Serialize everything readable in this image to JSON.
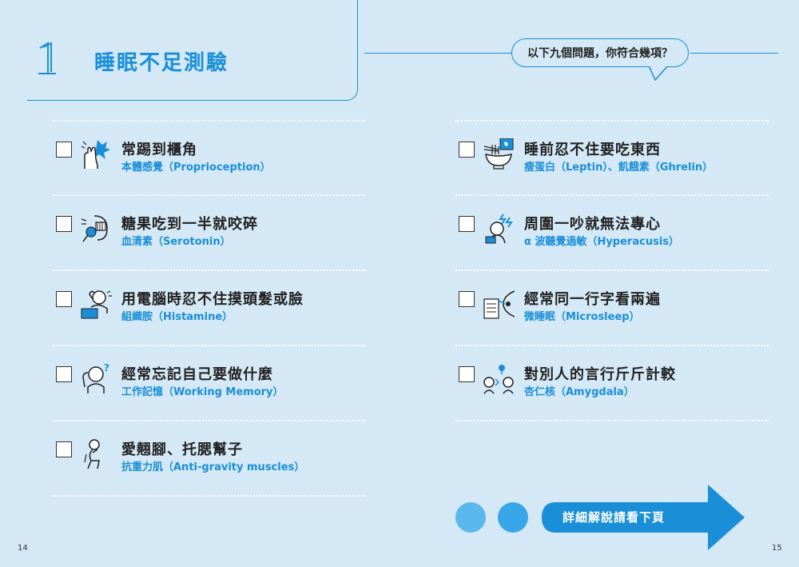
{
  "header": {
    "number": "1",
    "title": "睡眠不足測驗",
    "question": "以下九個問題，你符合幾項？"
  },
  "items_left": [
    {
      "main": "常踢到櫃角",
      "sub": "本體感覺（Proprioception）",
      "icon": "bump-hand-icon"
    },
    {
      "main": "糖果吃到一半就咬碎",
      "sub": "血清素（Serotonin）",
      "icon": "biting-candy-icon"
    },
    {
      "main": "用電腦時忍不住摸頭髮或臉",
      "sub": "組織胺（Histamine）",
      "icon": "computer-user-icon"
    },
    {
      "main": "經常忘記自己要做什麼",
      "sub": "工作記憶（Working Memory）",
      "icon": "confused-person-icon"
    },
    {
      "main": "愛翹腳、托腮幫子",
      "sub": "抗重力肌（Anti-gravity muscles）",
      "icon": "sitting-person-icon"
    }
  ],
  "items_right": [
    {
      "main": "睡前忍不住要吃東西",
      "sub": "瘦蛋白（Leptin）、飢餓素（Ghrelin）",
      "icon": "noodle-bowl-icon"
    },
    {
      "main": "周圍一吵就無法專心",
      "sub": "α 波聽覺過敏（Hyperacusis）",
      "icon": "noise-person-icon"
    },
    {
      "main": "經常同一行字看兩遍",
      "sub": "微睡眠（Microsleep）",
      "icon": "reading-eye-icon"
    },
    {
      "main": "對別人的言行斤斤計較",
      "sub": "杏仁核（Amygdala）",
      "icon": "arguing-people-icon"
    }
  ],
  "footer": {
    "next_label": "詳細解說請看下頁",
    "page_left": "14",
    "page_right": "15"
  },
  "colors": {
    "accent": "#1a8fd8",
    "background": "#d4e8f6",
    "circle1": "#5bb8ef",
    "circle2": "#3aa6ea",
    "arrow": "#1a8fd8"
  }
}
